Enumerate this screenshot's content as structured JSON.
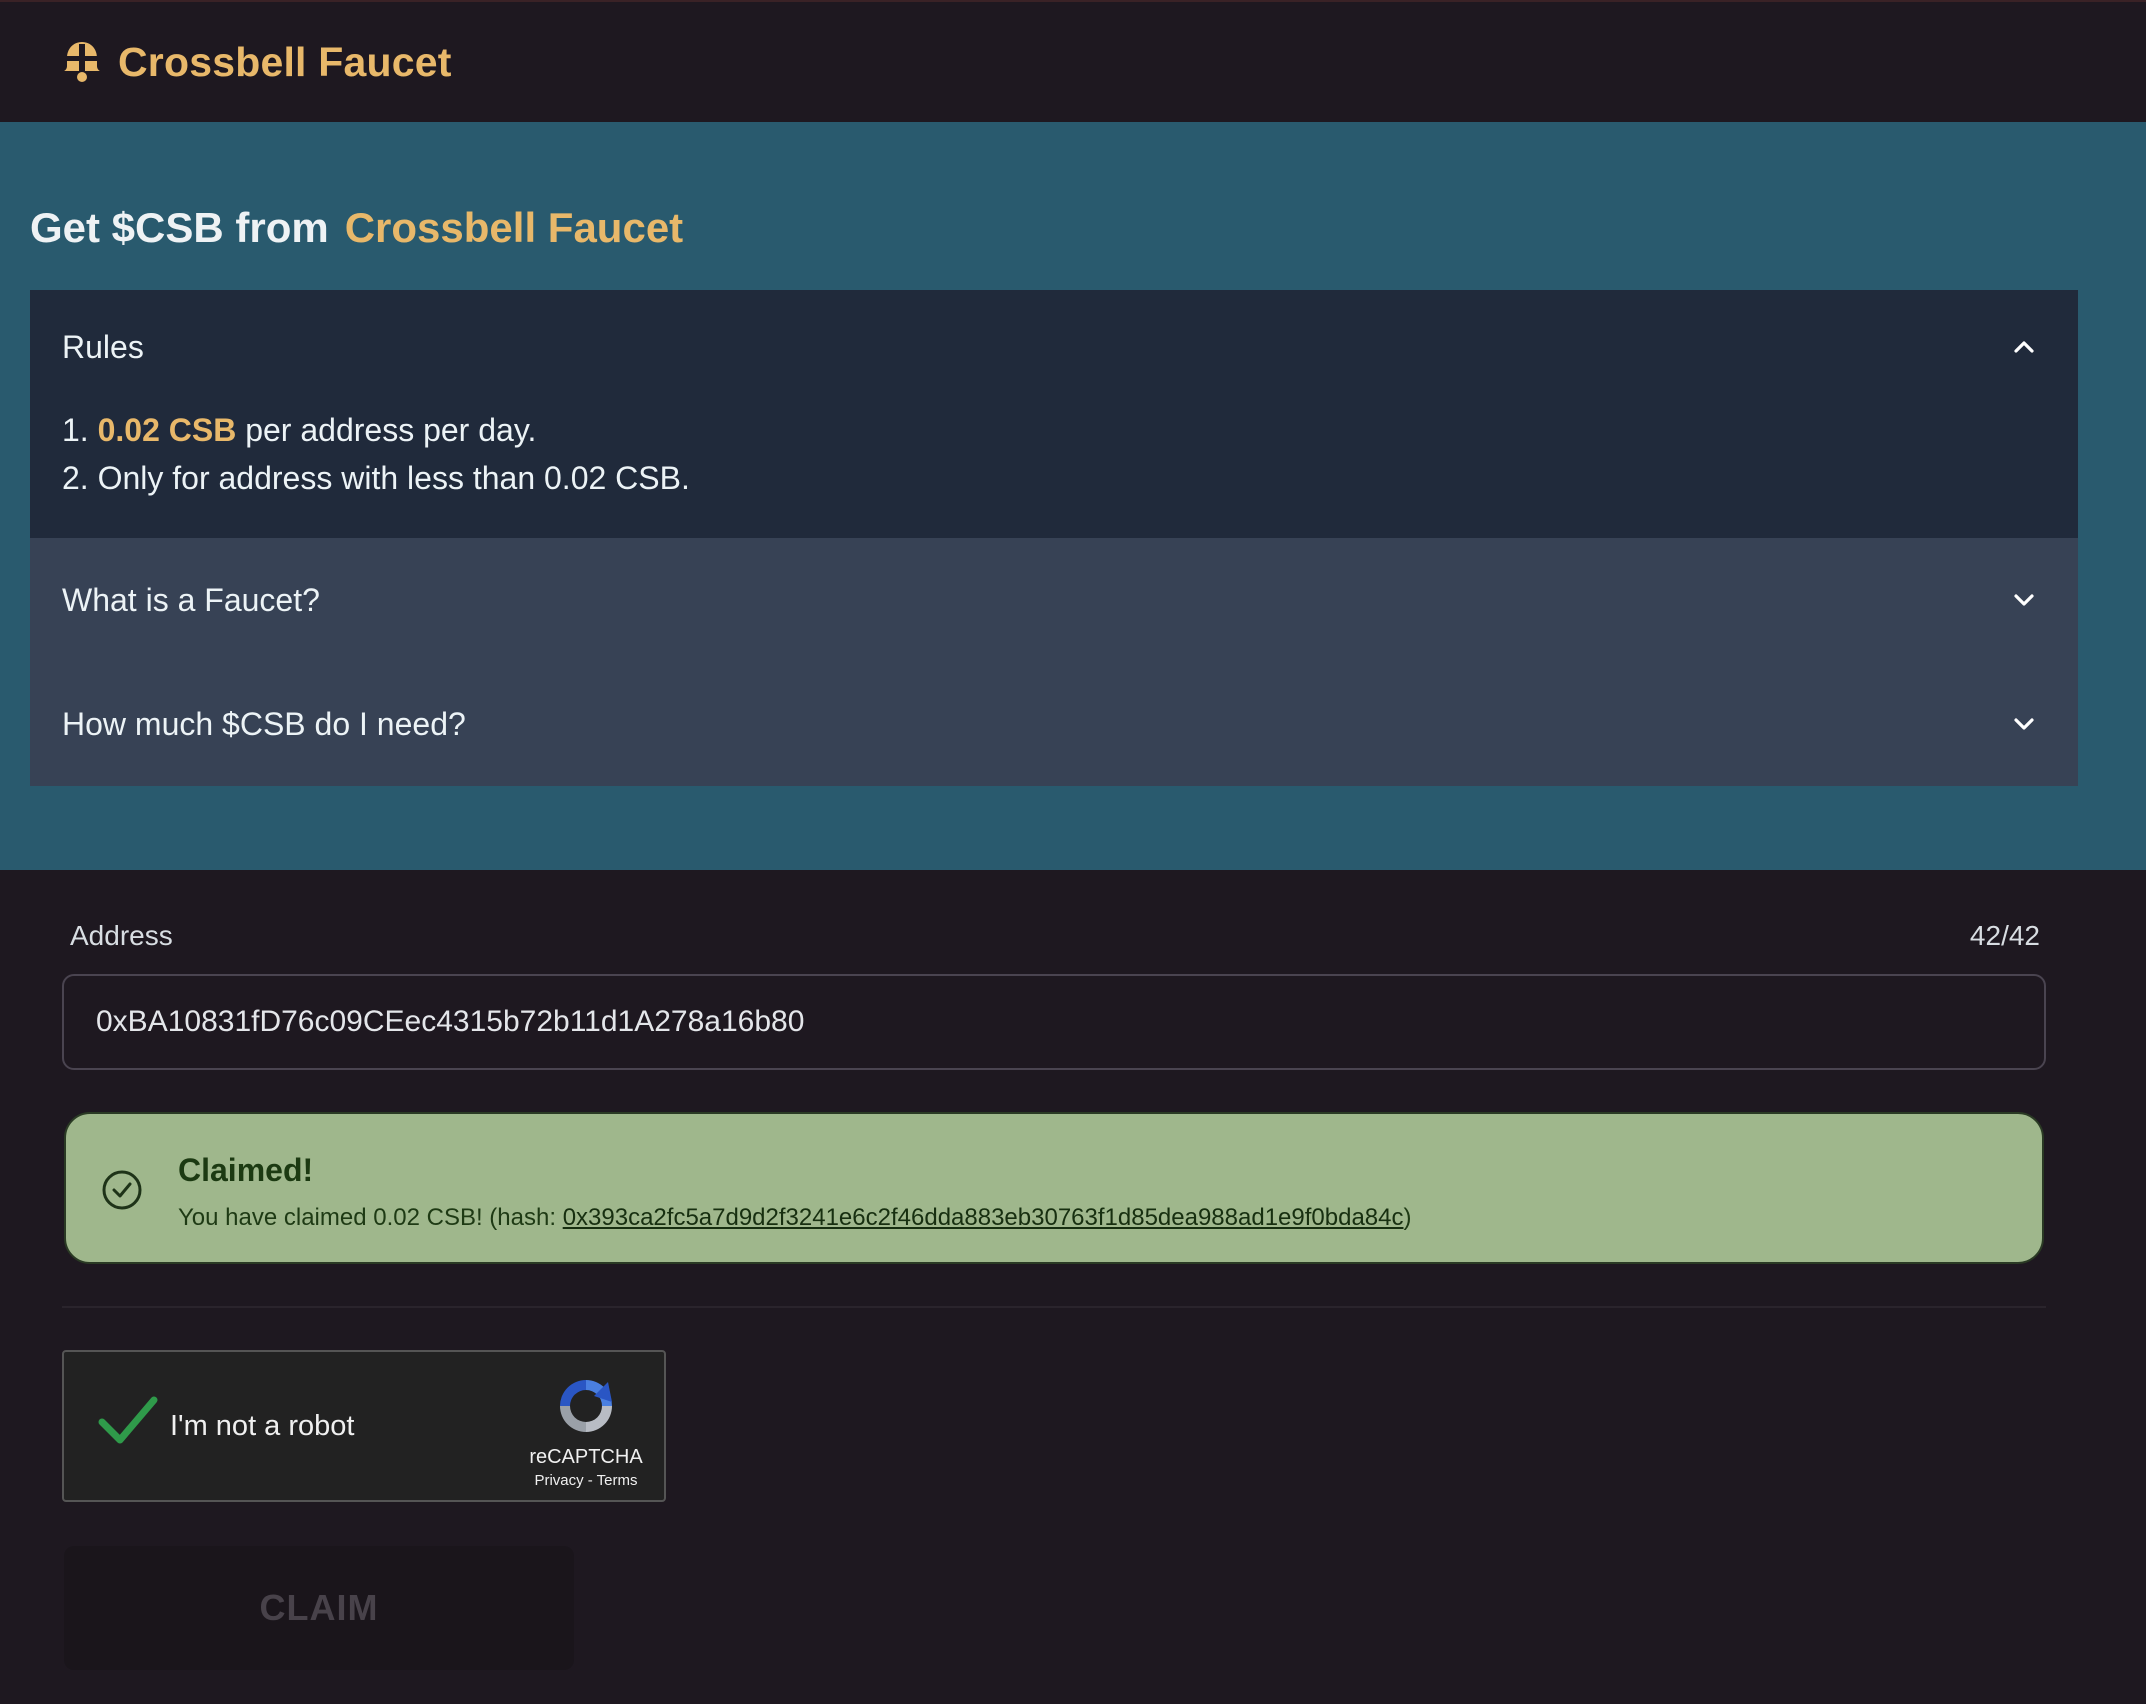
{
  "header": {
    "brand": "Crossbell Faucet",
    "logo_icon": "crossbell-bell-icon",
    "brand_color": "#e8b86a"
  },
  "hero": {
    "title_prefix": "Get $CSB from",
    "title_accent": "Crossbell Faucet",
    "background": "#295a6e"
  },
  "accordion": [
    {
      "title": "Rules",
      "expanded": true,
      "icon": "chevron-up-icon",
      "rule1_prefix": "1.",
      "rule1_highlight": "0.02 CSB",
      "rule1_suffix": "per address per day.",
      "rule2": "2. Only for address with less than 0.02 CSB."
    },
    {
      "title": "What is a Faucet?",
      "expanded": false,
      "icon": "chevron-down-icon"
    },
    {
      "title": "How much $CSB do I need?",
      "expanded": false,
      "icon": "chevron-down-icon"
    }
  ],
  "form": {
    "address_label": "Address",
    "counter": "42/42",
    "address_value": "0xBA10831fD76c09CEec4315b72b11d1A278a16b80"
  },
  "alert": {
    "icon": "check-circle-icon",
    "title": "Claimed!",
    "text_prefix": "You have claimed 0.02 CSB! (hash: ",
    "hash": "0x393ca2fc5a7d9d2f3241e6c2f46dda883eb30763f1d85dea988ad1e9f0bda84c",
    "text_suffix": ")",
    "color": "#9fb78c"
  },
  "recaptcha": {
    "label": "I'm not a robot",
    "brand": "reCAPTCHA",
    "links": "Privacy - Terms",
    "checked": true
  },
  "claim_button": {
    "label": "CLAIM",
    "disabled": true
  }
}
